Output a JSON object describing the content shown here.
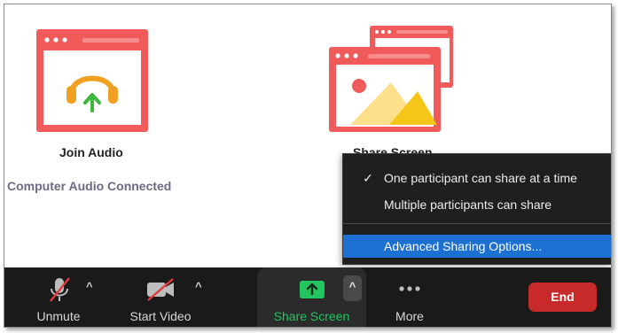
{
  "join_audio": {
    "title": "Join Audio",
    "status": "Computer Audio Connected",
    "icon": "headphones-upload-icon"
  },
  "share_screen_tile": {
    "title": "Share Screen",
    "icon": "share-screen-windows-icon"
  },
  "share_menu": {
    "items": [
      {
        "label": "One participant can share at a time",
        "checked": true
      },
      {
        "label": "Multiple participants can share",
        "checked": false
      },
      {
        "label": "Advanced Sharing Options...",
        "highlighted": true
      }
    ]
  },
  "toolbar": {
    "unmute_label": "Unmute",
    "start_video_label": "Start Video",
    "share_screen_label": "Share Screen",
    "more_label": "More",
    "end_label": "End"
  },
  "colors": {
    "tile_red": "#f05a5a",
    "headphones_orange": "#f0a020",
    "arrow_green": "#3cb83c",
    "share_green": "#22c55e",
    "menu_highlight": "#1c6fd3",
    "end_red": "#c82a2a",
    "toolbar_bg": "#1a1a1a"
  }
}
